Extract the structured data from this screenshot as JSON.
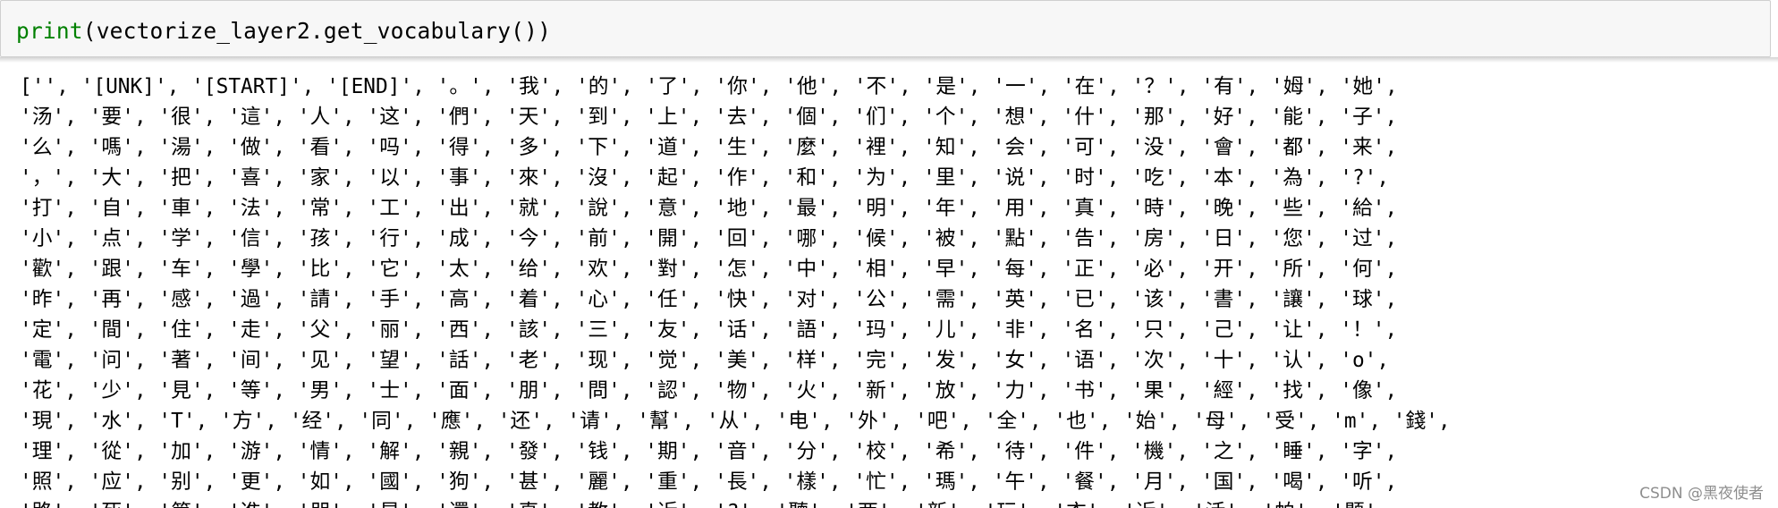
{
  "code_cell": {
    "builtin": "print",
    "args": "(vectorize_layer2.get_vocabulary())"
  },
  "output": {
    "lines": [
      "['', '[UNK]', '[START]', '[END]', '。', '我', '的', '了', '你', '他', '不', '是', '一', '在', '？', '有', '姆', '她',",
      "'汤', '要', '很', '這', '人', '这', '們', '天', '到', '上', '去', '個', '们', '个', '想', '什', '那', '好', '能', '子',",
      "'么', '嗎', '湯', '做', '看', '吗', '得', '多', '下', '道', '生', '麼', '裡', '知', '会', '可', '没', '會', '都', '来',",
      "'，', '大', '把', '喜', '家', '以', '事', '來', '沒', '起', '作', '和', '为', '里', '说', '时', '吃', '本', '為', '?',",
      "'打', '自', '車', '法', '常', '工', '出', '就', '說', '意', '地', '最', '明', '年', '用', '真', '時', '晚', '些', '給',",
      "'小', '点', '学', '信', '孩', '行', '成', '今', '前', '開', '回', '哪', '候', '被', '點', '告', '房', '日', '您', '过',",
      "'歡', '跟', '车', '學', '比', '它', '太', '给', '欢', '對', '怎', '中', '相', '早', '每', '正', '必', '开', '所', '何',",
      "'昨', '再', '感', '過', '請', '手', '高', '着', '心', '任', '快', '对', '公', '需', '英', '已', '该', '書', '讓', '球',",
      "'定', '間', '住', '走', '父', '丽', '西', '該', '三', '友', '话', '語', '玛', '儿', '非', '名', '只', '己', '让', '！',",
      "'電', '问', '著', '间', '见', '望', '話', '老', '现', '觉', '美', '样', '完', '发', '女', '语', '次', '十', '认', 'o',",
      "'花', '少', '見', '等', '男', '士', '面', '朋', '問', '認', '物', '火', '新', '放', '力', '书', '果', '經', '找', '像',",
      "'現', '水', 'T', '方', '经', '同', '應', '还', '请', '幫', '从', '电', '外', '吧', '全', '也', '始', '母', '受', 'm', '錢',",
      "'理', '從', '加', '游', '情', '解', '親', '發', '钱', '期', '音', '分', '校', '希', '待', '件', '機', '之', '睡', '字',",
      "'照', '应', '别', '更', '如', '國', '狗', '甚', '麗', '重', '長', '樣', '忙', '瑪', '午', '餐', '月', '国', '喝', '听',",
      "'路', '死', '第', '進', '朋', '星', '還', '真', '教', '近', '?', '聽', '两', '新', '玩', '衣', '近', '活', '帕', '题',"
    ]
  },
  "watermark": "CSDN @黑夜使者"
}
